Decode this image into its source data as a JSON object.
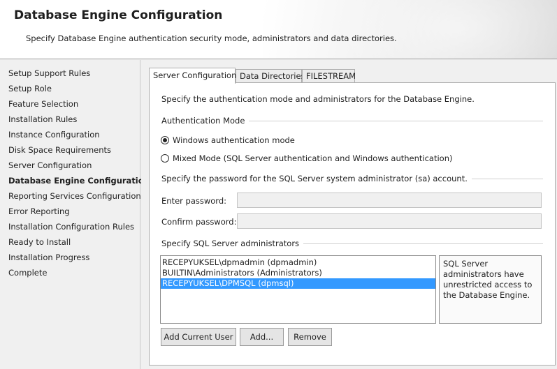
{
  "header": {
    "title": "Database Engine Configuration",
    "subtitle": "Specify Database Engine authentication security mode, administrators and data directories."
  },
  "sidebar": {
    "items": [
      {
        "label": "Setup Support Rules"
      },
      {
        "label": "Setup Role"
      },
      {
        "label": "Feature Selection"
      },
      {
        "label": "Installation Rules"
      },
      {
        "label": "Instance Configuration"
      },
      {
        "label": "Disk Space Requirements"
      },
      {
        "label": "Server Configuration"
      },
      {
        "label": "Database Engine Configuration",
        "active": true
      },
      {
        "label": "Reporting Services Configuration"
      },
      {
        "label": "Error Reporting"
      },
      {
        "label": "Installation Configuration Rules"
      },
      {
        "label": "Ready to Install"
      },
      {
        "label": "Installation Progress"
      },
      {
        "label": "Complete"
      }
    ]
  },
  "tabs": [
    {
      "label": "Server Configuration",
      "active": true
    },
    {
      "label": "Data Directories"
    },
    {
      "label": "FILESTREAM"
    }
  ],
  "server_config": {
    "intro": "Specify the authentication mode and administrators for the Database Engine.",
    "auth_mode_label": "Authentication Mode",
    "windows_auth_label": "Windows authentication mode",
    "mixed_mode_label": "Mixed Mode (SQL Server authentication and Windows authentication)",
    "selected_mode": "windows",
    "sa_password_label": "Specify the password for the SQL Server system administrator (sa) account.",
    "enter_password_label": "Enter password:",
    "enter_password_value": "",
    "confirm_password_label": "Confirm password:",
    "confirm_password_value": "",
    "admins_label": "Specify SQL Server administrators",
    "admins": [
      {
        "name": "RECEPYUKSEL\\dpmadmin (dpmadmin)"
      },
      {
        "name": "BUILTIN\\Administrators (Administrators)"
      },
      {
        "name": "RECEPYUKSEL\\DPMSQL (dpmsql)",
        "selected": true
      }
    ],
    "admins_info": "SQL Server administrators have unrestricted access to the Database Engine.",
    "add_current_user_label": "Add Current User",
    "add_label": "Add...",
    "remove_label": "Remove"
  },
  "colors": {
    "selection": "#3399ff",
    "panel_background": "#ffffff",
    "window_background": "#f0f0f0"
  }
}
